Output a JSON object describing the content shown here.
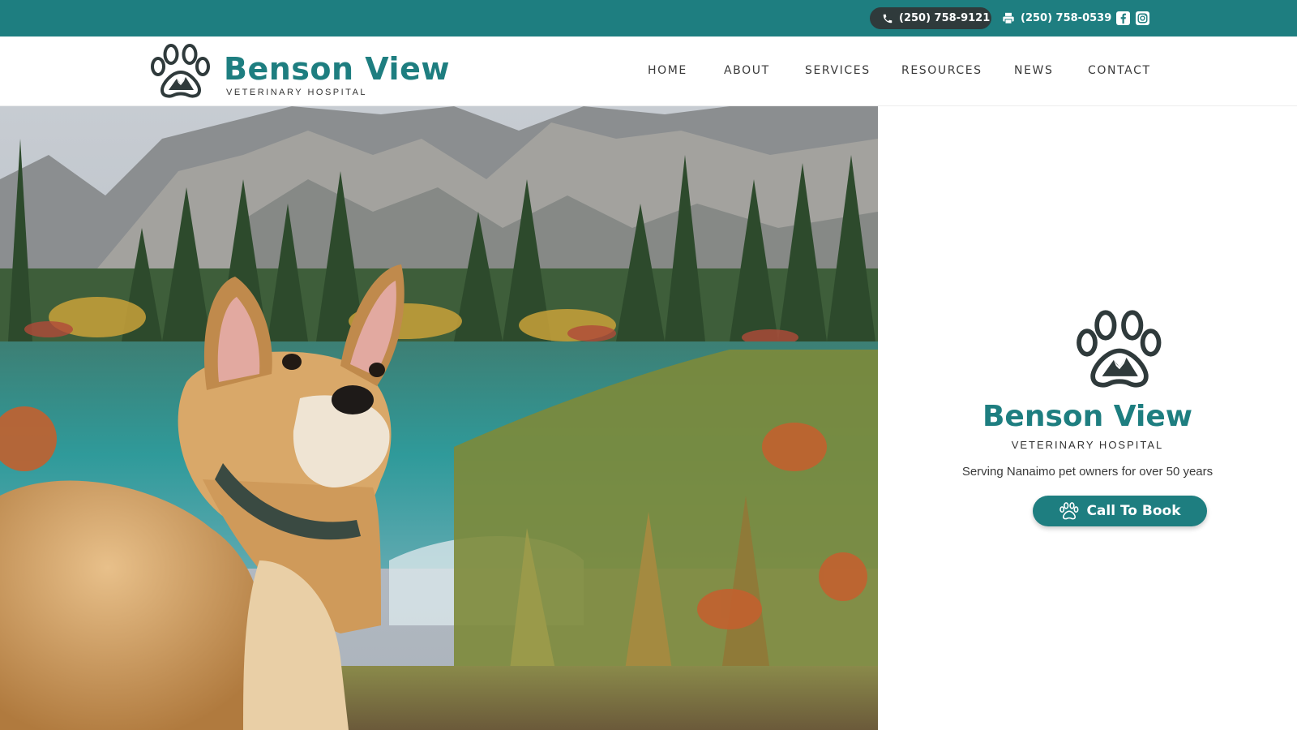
{
  "brand": {
    "name": "Benson View",
    "subtitle": "VETERINARY HOSPITAL",
    "primary_color": "#1e7e80",
    "dark_color": "#2f3a3b"
  },
  "topbar": {
    "phone": "(250) 758-9121",
    "phone_icon": "phone-icon",
    "fax": "(250) 758-0539",
    "fax_icon": "fax-icon",
    "social": [
      "facebook-icon",
      "instagram-icon"
    ]
  },
  "nav": {
    "items": [
      {
        "label": "HOME",
        "active": true
      },
      {
        "label": "ABOUT",
        "active": false
      },
      {
        "label": "SERVICES",
        "active": false
      },
      {
        "label": "RESOURCES",
        "active": false
      },
      {
        "label": "NEWS",
        "active": false
      },
      {
        "label": "CONTACT",
        "active": false
      }
    ]
  },
  "hero": {
    "photo_icon": "dog-by-mountain-lake-photo",
    "title": "Benson View",
    "subtitle": "VETERINARY HOSPITAL",
    "tagline": "Serving Nanaimo pet owners for over 50 years",
    "cta_label": "Call To Book",
    "cta_icon": "paw-icon"
  }
}
